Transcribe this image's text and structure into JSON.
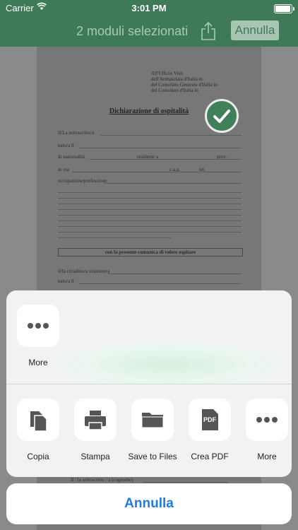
{
  "status_bar": {
    "carrier": "Carrier",
    "time": "3:01 PM"
  },
  "nav": {
    "title": "2 moduli selezionati",
    "cancel_label": "Annulla"
  },
  "document": {
    "address_lines": [
      "All'Ufficio Visti",
      "dell'Ambasciata d'Italia in",
      "del Consolato Generale d'Italia in",
      "del Consolato d'Italia in"
    ],
    "heading": "Dichiarazione di ospitalità",
    "fields": [
      "Il/La sottoscritto/a",
      "nato/a il",
      "di nazionalità",
      "residente a",
      "prov.",
      "in via",
      "c.a.p.",
      "tel.",
      "occupazione/professione"
    ],
    "section_title": "con la presente comunica di volere ospitare",
    "fields_2": [
      "il/la cittadino/a straniero/a",
      "nato/a il",
      "Il / la sottoscritto / a (cognome)"
    ]
  },
  "sheet": {
    "top_actions": [
      {
        "label": "More",
        "icon": "more-dots-icon"
      }
    ],
    "bottom_actions": [
      {
        "label": "Copia",
        "icon": "copy-icon"
      },
      {
        "label": "Stampa",
        "icon": "printer-icon"
      },
      {
        "label": "Save to Files",
        "icon": "folder-icon"
      },
      {
        "label": "Crea PDF",
        "icon": "pdf-icon",
        "badge": "PDF"
      },
      {
        "label": "More",
        "icon": "more-dots-icon"
      }
    ],
    "cancel_label": "Annulla"
  },
  "colors": {
    "header_green": "#3e7a58",
    "accent_blue": "#1e7de0"
  }
}
